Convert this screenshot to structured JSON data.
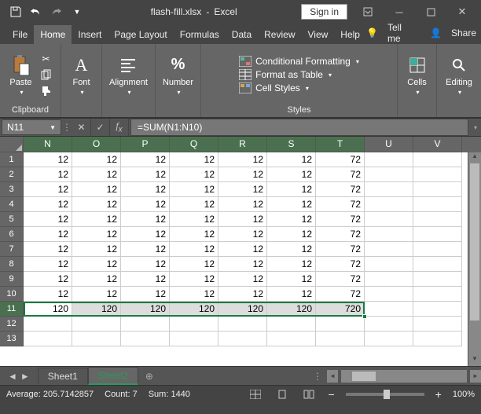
{
  "title": {
    "filename": "flash-fill.xlsx",
    "app": "Excel"
  },
  "signin": "Sign in",
  "menu": {
    "file": "File",
    "home": "Home",
    "insert": "Insert",
    "pagelayout": "Page Layout",
    "formulas": "Formulas",
    "data": "Data",
    "review": "Review",
    "view": "View",
    "help": "Help",
    "tellme": "Tell me",
    "share": "Share"
  },
  "ribbon": {
    "clipboard": {
      "paste": "Paste",
      "label": "Clipboard"
    },
    "font": {
      "btn": "Font"
    },
    "alignment": {
      "btn": "Alignment"
    },
    "number": {
      "btn": "Number"
    },
    "styles": {
      "cond": "Conditional Formatting",
      "table": "Format as Table",
      "cell": "Cell Styles",
      "label": "Styles"
    },
    "cells": {
      "btn": "Cells"
    },
    "editing": {
      "btn": "Editing"
    }
  },
  "namebox": "N11",
  "formula": "=SUM(N1:N10)",
  "columns": [
    "N",
    "O",
    "P",
    "Q",
    "R",
    "S",
    "T",
    "U",
    "V"
  ],
  "chart_data": {
    "type": "table",
    "columns": [
      "N",
      "O",
      "P",
      "Q",
      "R",
      "S",
      "T"
    ],
    "rows": [
      [
        12,
        12,
        12,
        12,
        12,
        12,
        72
      ],
      [
        12,
        12,
        12,
        12,
        12,
        12,
        72
      ],
      [
        12,
        12,
        12,
        12,
        12,
        12,
        72
      ],
      [
        12,
        12,
        12,
        12,
        12,
        12,
        72
      ],
      [
        12,
        12,
        12,
        12,
        12,
        12,
        72
      ],
      [
        12,
        12,
        12,
        12,
        12,
        12,
        72
      ],
      [
        12,
        12,
        12,
        12,
        12,
        12,
        72
      ],
      [
        12,
        12,
        12,
        12,
        12,
        12,
        72
      ],
      [
        12,
        12,
        12,
        12,
        12,
        12,
        72
      ],
      [
        12,
        12,
        12,
        12,
        12,
        12,
        72
      ],
      [
        120,
        120,
        120,
        120,
        120,
        120,
        720
      ]
    ]
  },
  "sheets": {
    "s1": "Sheet1",
    "s2": "Sheet2"
  },
  "status": {
    "avg": "Average: 205.7142857",
    "count": "Count: 7",
    "sum": "Sum: 1440",
    "zoom": "100%"
  }
}
